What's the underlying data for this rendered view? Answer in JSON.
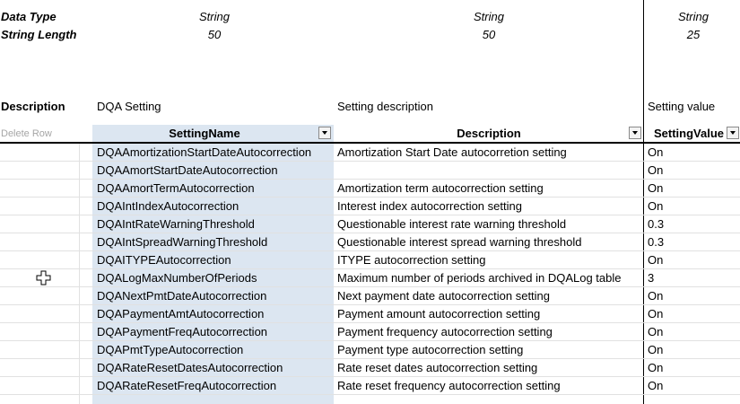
{
  "meta": {
    "data_type_label": "Data Type",
    "string_length_label": "String Length",
    "col_setting_name": {
      "type": "String",
      "length": "50"
    },
    "col_description": {
      "type": "String",
      "length": "50"
    },
    "col_setting_value": {
      "type": "String",
      "length": "25"
    }
  },
  "captions": {
    "description": "Description",
    "dqa_setting": "DQA Setting",
    "setting_description": "Setting description",
    "setting_value": "Setting value"
  },
  "table": {
    "delete_row": "Delete Row",
    "headers": {
      "setting_name": "SettingName",
      "description": "Description",
      "setting_value": "SettingValue"
    },
    "rows": [
      {
        "name": "DQAAmortizationStartDateAutocorrection",
        "description": "Amortization Start Date autocorretion setting",
        "value": "On"
      },
      {
        "name": "DQAAmortStartDateAutocorrection",
        "description": "",
        "value": "On"
      },
      {
        "name": "DQAAmortTermAutocorrection",
        "description": "Amortization term autocorrection setting",
        "value": "On"
      },
      {
        "name": "DQAIntIndexAutocorrection",
        "description": "Interest index autocorrection setting",
        "value": "On"
      },
      {
        "name": "DQAIntRateWarningThreshold",
        "description": "Questionable interest rate warning threshold",
        "value": "0.3"
      },
      {
        "name": "DQAIntSpreadWarningThreshold",
        "description": "Questionable interest spread warning threshold",
        "value": "0.3"
      },
      {
        "name": "DQAITYPEAutocorrection",
        "description": "ITYPE autocorrection setting",
        "value": "On"
      },
      {
        "name": "DQALogMaxNumberOfPeriods",
        "description": "Maximum number of periods archived in DQALog table",
        "value": "3"
      },
      {
        "name": "DQANextPmtDateAutocorrection",
        "description": "Next payment date autocorrection setting",
        "value": "On"
      },
      {
        "name": "DQAPaymentAmtAutocorrection",
        "description": "Payment amount autocorrection setting",
        "value": "On"
      },
      {
        "name": "DQAPaymentFreqAutocorrection",
        "description": "Payment frequency autocorrection setting",
        "value": "On"
      },
      {
        "name": "DQAPmtTypeAutocorrection",
        "description": "Payment type autocorrection setting",
        "value": "On"
      },
      {
        "name": "DQARateResetDatesAutocorrection",
        "description": "Rate reset dates autocorrection setting",
        "value": "On"
      },
      {
        "name": "DQARateResetFreqAutocorrection",
        "description": "Rate reset frequency autocorrection setting",
        "value": "On"
      }
    ]
  },
  "colors": {
    "name_fill": "#dce6f1",
    "header_border": "#000000",
    "grid": "#e1e1e1",
    "delete_row_text": "#a6a6a6"
  },
  "icons": {
    "cursor": "move-cursor-icon",
    "filter": "dropdown-filter-icon"
  }
}
